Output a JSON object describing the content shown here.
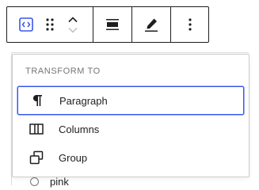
{
  "toolbar": {
    "buttons": {
      "block_type": "block-type-icon",
      "drag": "drag-handle-icon",
      "move_up": "chevron-up-icon",
      "move_down": "chevron-down-icon",
      "align": "align-icon",
      "edit": "pencil-icon",
      "more": "more-vertical-icon"
    }
  },
  "transform_menu": {
    "heading": "TRANSFORM TO",
    "items": [
      {
        "label": "Paragraph",
        "icon": "paragraph-icon",
        "focused": true
      },
      {
        "label": "Columns",
        "icon": "columns-icon",
        "focused": false
      },
      {
        "label": "Group",
        "icon": "group-icon",
        "focused": false
      }
    ]
  },
  "background_list": {
    "peek_item_label": "pink"
  },
  "colors": {
    "accent": "#3858e9",
    "text": "#1e1e1e",
    "muted": "#757575"
  }
}
